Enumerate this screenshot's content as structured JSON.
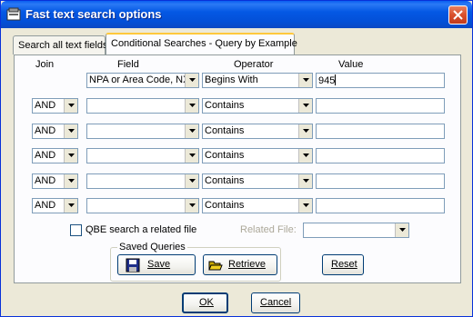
{
  "window": {
    "title": "Fast text search options"
  },
  "tabs": [
    {
      "label": "Search all text fields"
    },
    {
      "label": "Conditional Searches - Query by Example"
    }
  ],
  "columns": {
    "join": "Join",
    "field": "Field",
    "operator": "Operator",
    "value": "Value"
  },
  "rows": [
    {
      "join": "",
      "field": "NPA or Area Code, NX",
      "operator": "Begins With",
      "value": "945"
    },
    {
      "join": "AND",
      "field": "",
      "operator": "Contains",
      "value": ""
    },
    {
      "join": "AND",
      "field": "",
      "operator": "Contains",
      "value": ""
    },
    {
      "join": "AND",
      "field": "",
      "operator": "Contains",
      "value": ""
    },
    {
      "join": "AND",
      "field": "",
      "operator": "Contains",
      "value": ""
    },
    {
      "join": "AND",
      "field": "",
      "operator": "Contains",
      "value": ""
    }
  ],
  "qbe_related": {
    "label": "QBE search a related file",
    "checked": false
  },
  "related_file": {
    "label": "Related File:",
    "value": ""
  },
  "saved_queries": {
    "group_label": "Saved Queries",
    "save_label": "Save",
    "retrieve_label": "Retrieve"
  },
  "reset_label": "Reset",
  "ok_label": "OK",
  "cancel_label": "Cancel",
  "colors": {
    "titlebar": "#0458e4",
    "close_button": "#d9502c",
    "face": "#ece9d8",
    "active_tab_accent": "#ffc83c"
  },
  "icons": {
    "window": "dialog-app-icon",
    "close": "close-icon",
    "save": "floppy-disk-icon",
    "retrieve": "folder-open-icon"
  }
}
